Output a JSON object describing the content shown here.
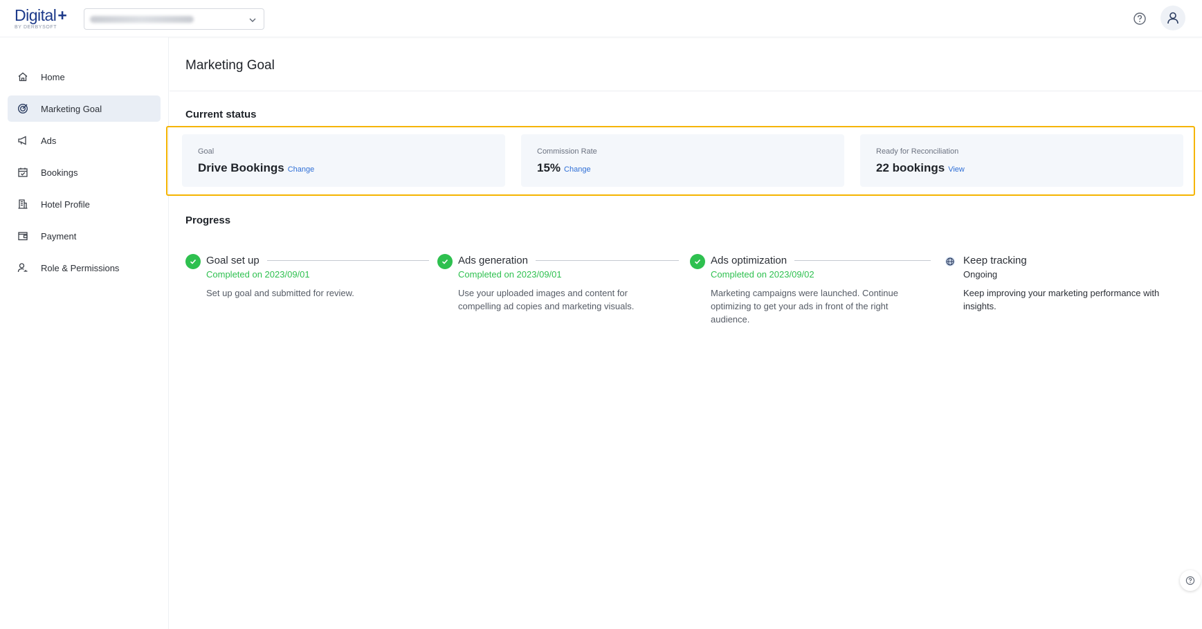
{
  "brand": {
    "name": "Digital",
    "plus": "+",
    "sub": "BY DERBYSOFT"
  },
  "header": {
    "hotel_select_value": ""
  },
  "sidebar": {
    "items": [
      {
        "label": "Home",
        "icon": "home-icon"
      },
      {
        "label": "Marketing Goal",
        "icon": "target-icon"
      },
      {
        "label": "Ads",
        "icon": "megaphone-icon"
      },
      {
        "label": "Bookings",
        "icon": "calendar-icon"
      },
      {
        "label": "Hotel Profile",
        "icon": "building-icon"
      },
      {
        "label": "Payment",
        "icon": "wallet-icon"
      },
      {
        "label": "Role & Permissions",
        "icon": "user-icon"
      }
    ],
    "active_index": 1
  },
  "main": {
    "title": "Marketing Goal",
    "current_status": {
      "heading": "Current status",
      "cards": [
        {
          "label": "Goal",
          "value": "Drive Bookings",
          "link": "Change"
        },
        {
          "label": "Commission Rate",
          "value": "15%",
          "link": "Change"
        },
        {
          "label": "Ready for Reconciliation",
          "value": "22 bookings",
          "link": "View"
        }
      ]
    },
    "progress": {
      "heading": "Progress",
      "steps": [
        {
          "title": "Goal set up",
          "date": "Completed on 2023/09/01",
          "desc": "Set up goal and submitted for review.",
          "state": "done"
        },
        {
          "title": "Ads generation",
          "date": "Completed on 2023/09/01",
          "desc": "Use your uploaded images and content for compelling ad copies and marketing visuals.",
          "state": "done"
        },
        {
          "title": "Ads optimization",
          "date": "Completed on 2023/09/02",
          "desc": "Marketing campaigns were launched. Continue optimizing to get your ads in front of the right audience.",
          "state": "done"
        },
        {
          "title": "Keep tracking",
          "status": "Ongoing",
          "desc": "Keep improving your marketing performance with insights.",
          "state": "ongoing"
        }
      ]
    }
  },
  "colors": {
    "accent": "#2f6fd6",
    "success": "#2ec04f",
    "highlight": "#f5b400",
    "brand": "#1d3a8a"
  }
}
